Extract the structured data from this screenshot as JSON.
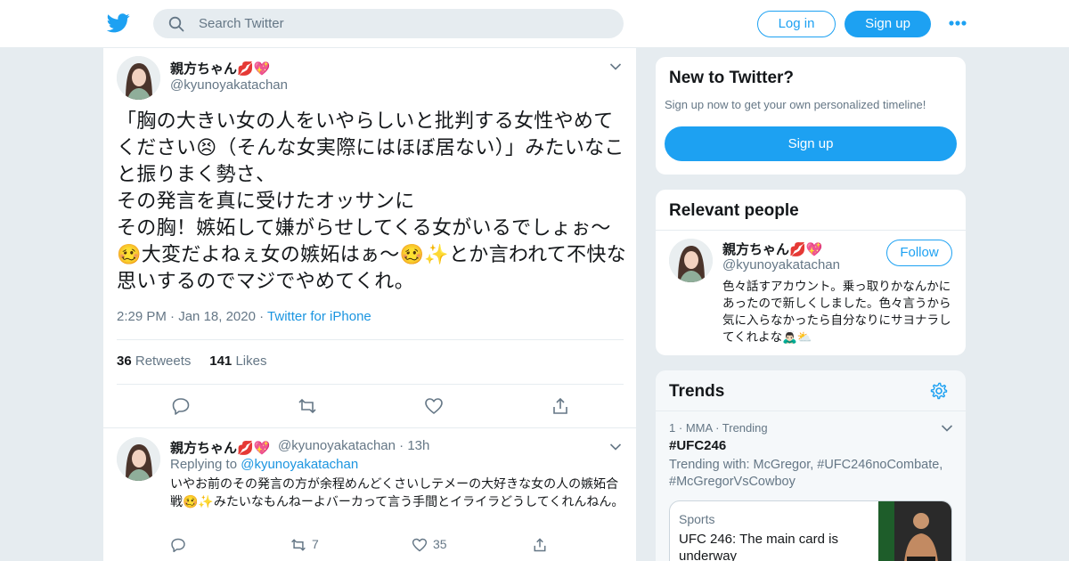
{
  "header": {
    "search_placeholder": "Search Twitter",
    "login_label": "Log in",
    "signup_label": "Sign up"
  },
  "tweet": {
    "display_name": "親方ちゃん💋💖",
    "handle": "@kyunoyakatachan",
    "text": "「胸の大きい女の人をいやらしいと批判する女性やめてください😣（そんな女実際にはほぼ居ない）」みたいなこと振りまく勢さ、\nその発言を真に受けたオッサンに\nその胸！嫉妬して嫌がらせしてくる女がいるでしょぉ〜🥴大変だよねぇ女の嫉妬はぁ〜🥴✨とか言われて不快な思いするのでマジでやめてくれ。",
    "time": "2:29 PM",
    "date": "Jan 18, 2020",
    "source": "Twitter for iPhone",
    "retweets_count": "36",
    "retweets_label": "Retweets",
    "likes_count": "141",
    "likes_label": "Likes"
  },
  "reply": {
    "display_name": "親方ちゃん💋💖",
    "handle": "@kyunoyakatachan",
    "age": "13h",
    "replying_prefix": "Replying to",
    "replying_handle": "@kyunoyakatachan",
    "text": "いやお前のその発言の方が余程めんどくさいしテメーの大好きな女の人の嫉妬合戦🥴✨みたいなもんねーよバーカって言う手間とイライラどうしてくれんねん。",
    "retweets": "7",
    "likes": "35"
  },
  "sidebar": {
    "new_title": "New to Twitter?",
    "new_subtitle": "Sign up now to get your own personalized timeline!",
    "new_signup_label": "Sign up",
    "relevant_title": "Relevant people",
    "person": {
      "display_name": "親方ちゃん💋💖",
      "handle": "@kyunoyakatachan",
      "follow_label": "Follow",
      "bio": "色々話すアカウント。乗っ取りかなんかにあったので新しくしました。色々言うから気に入らなかったら自分なりにサヨナラしてくれよな🙇🏻‍♂️⛅"
    },
    "trends_title": "Trends",
    "trend": {
      "rank": "1",
      "category": "MMA",
      "status": "Trending",
      "hashtag": "#UFC246",
      "trending_with": "Trending with: McGregor, #UFC246noCombate, #McGregorVsCowboy",
      "card_category": "Sports",
      "card_title": "UFC 246: The main card is underway"
    }
  },
  "colors": {
    "accent": "#1da1f2",
    "link": "#1b95e0",
    "muted": "#657786",
    "text": "#14171a",
    "border": "#e6ecf0"
  },
  "icons": [
    "twitter-bird-icon",
    "search-icon",
    "more-dots-icon",
    "chevron-down-icon",
    "reply-icon",
    "retweet-icon",
    "like-icon",
    "share-icon",
    "gear-icon"
  ]
}
